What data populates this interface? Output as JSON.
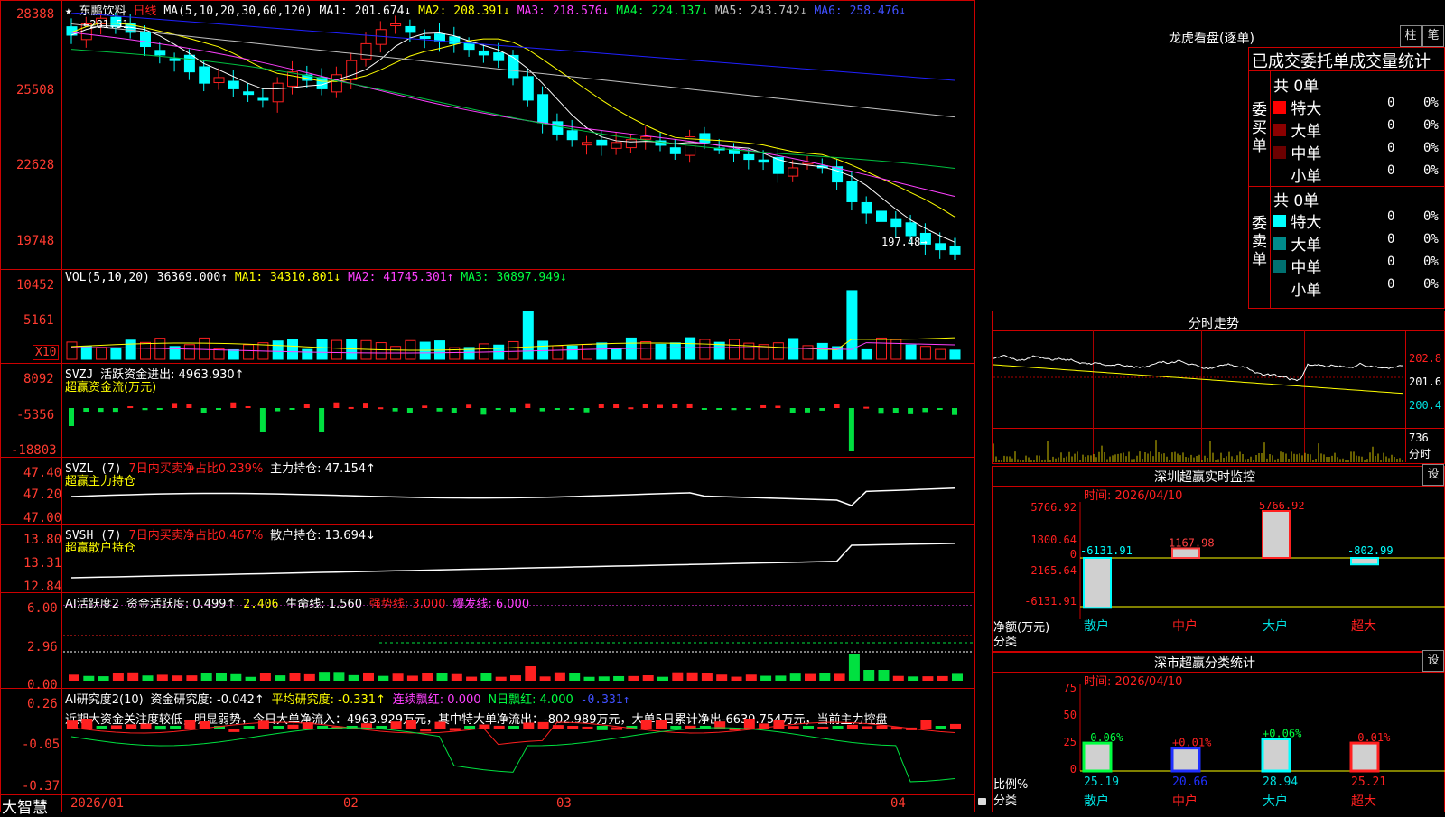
{
  "header": {
    "star": "★",
    "stock_name": "东鹏饮料",
    "period": "日线",
    "ma_spec": "MA(5,10,20,30,60,120)",
    "ma1": "MA1: 201.674↓",
    "ma2": "MA2: 208.391↓",
    "ma3": "MA3: 218.576↓",
    "ma4": "MA4: 224.137↓",
    "ma5": "MA5: 243.742↓",
    "ma6": "MA6: 258.476↓"
  },
  "price_axis": [
    "28388",
    "25508",
    "22628",
    "19748"
  ],
  "price_marks": {
    "high": "←281.51",
    "low": "197.48→"
  },
  "vol": {
    "label": "VOL(5,10,20)",
    "value": "36369.000↑",
    "ma1": "MA1: 34310.801↓",
    "ma2": "MA2: 41745.301↑",
    "ma3": "MA3: 30897.949↓",
    "axis": [
      "10452",
      "5161"
    ],
    "unit": "X10"
  },
  "svzj": {
    "label": "SVZJ",
    "desc": "活跃资金进出: 4963.930↑",
    "sub": "超赢资金流(万元)",
    "axis": [
      "8092",
      "-5356",
      "-18803"
    ]
  },
  "svzl": {
    "label": "SVZL (7)",
    "desc": "7日内买卖净占比0.239%",
    "hold": "主力持仓: 47.154↑",
    "sub": "超赢主力持仓",
    "axis": [
      "47.40",
      "47.20",
      "47.00"
    ]
  },
  "svsh": {
    "label": "SVSH (7)",
    "desc": "7日内买卖净占比0.467%",
    "hold": "散户持仓: 13.694↓",
    "sub": "超赢散户持仓",
    "axis": [
      "13.80",
      "13.31",
      "12.84"
    ]
  },
  "ai_active": {
    "label": "AI活跃度2",
    "desc": "资金活跃度: 0.499↑",
    "v2": "2.406",
    "life": "生命线: 1.560",
    "strong": "强势线: 3.000",
    "burst": "爆发线: 6.000",
    "axis": [
      "6.00",
      "2.96",
      "0.00"
    ]
  },
  "ai_research": {
    "label": "AI研究度2(10)",
    "desc": "资金研究度: -0.042↑",
    "avg": "平均研究度: -0.331↑",
    "red": "连续飘红: 0.000",
    "nred": "N日飘红: 4.000",
    "last": "-0.331↑",
    "comment": "近期大资金关注度较低，明显弱势，今日大单净流入：4963.929万元，其中特大单净流出：-802.989万元，大单5日累计净出-6639.754万元，当前主力控盘",
    "axis": [
      "0.26",
      "-0.05",
      "-0.37"
    ]
  },
  "date_axis": [
    "2026/01",
    "02",
    "03",
    "04"
  ],
  "brand": "大智慧",
  "longhu": {
    "title": "龙虎看盘(逐单)",
    "btn1": "柱",
    "btn2": "笔",
    "header": "已成交委托单成交量统计",
    "buy_label": "委买单",
    "sell_label": "委卖单",
    "buy_total": "共 0单",
    "sell_total": "共 0单",
    "rows": [
      "特大",
      "大单",
      "中单",
      "小单"
    ],
    "zero": "0",
    "pct": "0%",
    "buy_colors": [
      "#ff0000",
      "#8b0000",
      "#6b0000",
      "#000000"
    ],
    "sell_colors": [
      "#00ffff",
      "#008b8b",
      "#007070",
      "#000000"
    ]
  },
  "intraday": {
    "title": "分时走势",
    "axis": [
      "202.8",
      "201.6",
      "200.4"
    ],
    "vol_axis": "736",
    "vol_label": "分时"
  },
  "monitor": {
    "title": "深圳超赢实时监控",
    "btn": "设",
    "time": "时间: 2026/04/10",
    "axis": [
      "5766.92",
      "1800.64",
      "0",
      "-2165.64",
      "-6131.91"
    ],
    "unit": "净额(万元)",
    "cat_label": "分类",
    "categories": [
      "散户",
      "中户",
      "大户",
      "超大"
    ],
    "values": [
      -6131.91,
      1167.98,
      5766.92,
      -802.99
    ],
    "value_labels": [
      "-6131.91",
      "1167.98",
      "5766.92",
      "-802.99"
    ]
  },
  "classify": {
    "title": "深市超赢分类统计",
    "btn": "设",
    "time": "时间: 2026/04/10",
    "axis": [
      "75",
      "50",
      "25",
      "0"
    ],
    "unit": "比例%",
    "cat_label": "分类",
    "categories": [
      "散户",
      "中户",
      "大户",
      "超大"
    ],
    "values": [
      25.19,
      20.66,
      28.94,
      25.21
    ],
    "value_labels": [
      "25.19",
      "20.66",
      "28.94",
      "25.21"
    ],
    "changes": [
      "-0.06%",
      "+0.01%",
      "+0.06%",
      "-0.01%"
    ]
  },
  "colors": {
    "up": "#ff2020",
    "down": "#00ffff",
    "grid": "#c00000"
  }
}
